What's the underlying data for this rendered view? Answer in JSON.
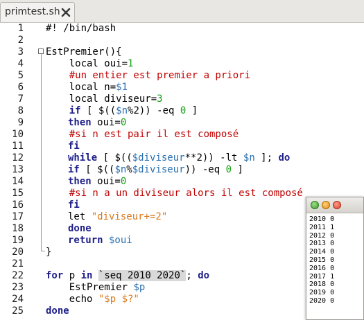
{
  "tab": {
    "title": "primtest.sh",
    "close_icon": "close-icon"
  },
  "line_numbers": [
    "1",
    "2",
    "3",
    "4",
    "5",
    "6",
    "7",
    "8",
    "9",
    "10",
    "11",
    "12",
    "13",
    "14",
    "15",
    "16",
    "17",
    "18",
    "19",
    "20",
    "21",
    "22",
    "23",
    "24",
    "25"
  ],
  "code": {
    "l1": "#! /bin/bash",
    "l3": "EstPremier(){",
    "l4_a": "    local oui=",
    "l4_b": "1",
    "l5": "    #un entier est premier a priori",
    "l6_a": "    local n=",
    "l6_b": "$1",
    "l7_a": "    local diviseur=",
    "l7_b": "3",
    "l8_a": "    ",
    "l8_kw": "if",
    "l8_b": " [ $((",
    "l8_v": "$n",
    "l8_c": "%2)) -eq ",
    "l8_n": "0",
    "l8_d": " ]",
    "l9_kw": "then",
    "l9_a": " oui=",
    "l9_n": "0",
    "l10": "    #si n est pair il est composé",
    "l11_kw": "fi",
    "l12_kw": "while",
    "l12_a": " [ $((",
    "l12_v": "$diviseur",
    "l12_b": "**2)) -lt ",
    "l12_v2": "$n",
    "l12_c": " ]; ",
    "l12_kw2": "do",
    "l13_kw": "if",
    "l13_a": " [ $((",
    "l13_v": "$n",
    "l13_b": "%",
    "l13_v2": "$diviseur",
    "l13_c": ")) -eq ",
    "l13_n": "0",
    "l13_d": " ]",
    "l14_kw": "then",
    "l14_a": " oui=",
    "l14_n": "0",
    "l15": "    #si n a un diviseur alors il est composé",
    "l16_kw": "fi",
    "l17_a": "let ",
    "l17_s": "\"diviseur+=2\"",
    "l18_kw": "done",
    "l19_kw": "return",
    "l19_v": " $oui",
    "l20": "}",
    "l22_kw": "for",
    "l22_a": " p ",
    "l22_kw2": "in",
    "l22_sp": " ",
    "l22_bt": "`seq 2010 2020`",
    "l22_b": "; ",
    "l22_kw3": "do",
    "l23_a": "    EstPremier ",
    "l23_v": "$p",
    "l24_a": "    echo ",
    "l24_s": "\"$p $?\"",
    "l25_kw": "done"
  },
  "terminal": {
    "lines": [
      "2010 0",
      "2011 1",
      "2012 0",
      "2013 0",
      "2014 0",
      "2015 0",
      "2016 0",
      "2017 1",
      "2018 0",
      "2019 0",
      "2020 0"
    ]
  },
  "colors": {
    "keyword": "#1e1e8a",
    "comment": "#c00000",
    "variable": "#2a6fb0",
    "number": "#12a012",
    "string": "#d9781a"
  }
}
